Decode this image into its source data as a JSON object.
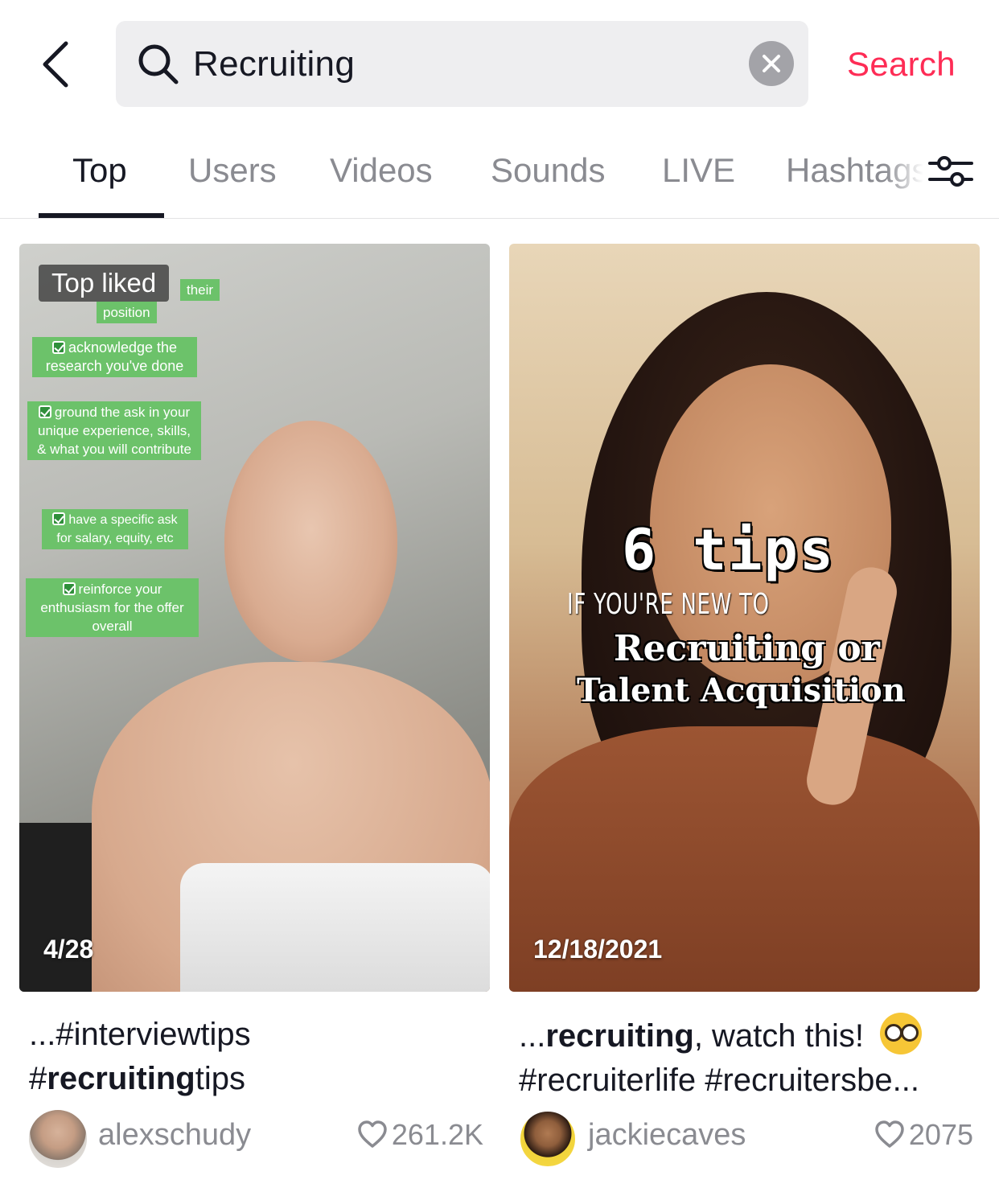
{
  "header": {
    "search_query": "Recruiting",
    "search_button_label": "Search",
    "icons": {
      "back": "chevron-left-icon",
      "search": "search-icon",
      "clear": "clear-icon",
      "filter": "filter-icon"
    }
  },
  "tabs": [
    {
      "label": "Top",
      "active": true
    },
    {
      "label": "Users",
      "active": false
    },
    {
      "label": "Videos",
      "active": false
    },
    {
      "label": "Sounds",
      "active": false
    },
    {
      "label": "LIVE",
      "active": false
    },
    {
      "label": "Hashtags",
      "active": false
    }
  ],
  "results": [
    {
      "badge": "Top liked",
      "date": "4/28",
      "overlay_tags": [
        "their",
        "position",
        "acknowledge the research you've done",
        "ground the ask in your unique experience, skills, & what you will contribute",
        "have a specific ask for salary, equity, etc",
        "reinforce your enthusiasm for the offer overall"
      ],
      "caption_line1": "...#interviewtips",
      "caption_line2_prefix": "#",
      "caption_line2_bold": "recruiting",
      "caption_line2_suffix": "tips",
      "username": "alexschudy",
      "likes": "261.2K"
    },
    {
      "date": "12/18/2021",
      "overlay": {
        "line1": "6 tips",
        "line2": "IF YOU'RE NEW TO",
        "line3": "Recruiting or",
        "line4": "Talent Acquisition"
      },
      "caption_line1_prefix": "...",
      "caption_line1_bold": "recruiting",
      "caption_line1_suffix": ", watch this!",
      "caption_emoji": "nerd-face-emoji",
      "caption_line2": "#recruiterlife #recruitersbe...",
      "username": "jackiecaves",
      "likes": "2075"
    }
  ]
}
